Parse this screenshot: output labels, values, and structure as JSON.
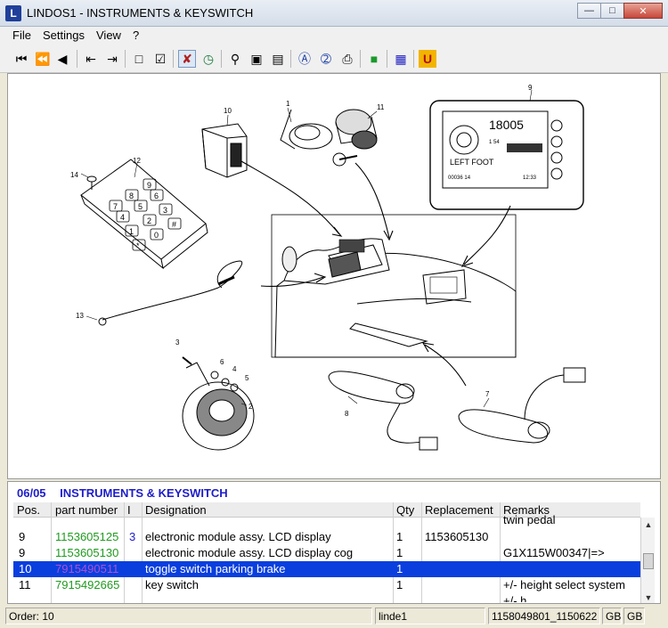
{
  "window": {
    "icon_letter": "L",
    "title": "LINDOS1 - INSTRUMENTS & KEYSWITCH"
  },
  "menu": [
    "File",
    "Settings",
    "View",
    "?"
  ],
  "toolbar_icons": [
    "first-page-icon",
    "prev-group-icon",
    "prev-icon",
    "bookmark-back-icon",
    "bookmark-forward-icon",
    "cart-icon",
    "order-list-icon",
    "pick-icon",
    "clock-icon",
    "zoom-icon",
    "page-icon",
    "page-alt-icon",
    "search-a-icon",
    "search-2-icon",
    "print-icon",
    "green-book-icon",
    "blue-grid-icon",
    "u-icon"
  ],
  "drawing": {
    "callouts": [
      "1",
      "2",
      "3",
      "4",
      "5",
      "6",
      "7",
      "8",
      "9",
      "10",
      "11",
      "12",
      "13",
      "14"
    ],
    "display": {
      "digits": "18005",
      "message": "LEFT FOOT",
      "counter": "00036 14",
      "time": "12:33",
      "small": "1 54"
    },
    "keypad": [
      "7",
      "8",
      "9",
      "4",
      "5",
      "6",
      "1",
      "2",
      "3",
      "*",
      "0",
      "#"
    ]
  },
  "parts": {
    "section_code": "06/05",
    "section_title": "INSTRUMENTS & KEYSWITCH",
    "headers": {
      "pos": "Pos.",
      "part_number": "part number",
      "i": "I",
      "designation": "Designation",
      "qty": "Qty",
      "replacement": "Replacement",
      "remarks": "Remarks"
    },
    "rows": [
      {
        "pos": "",
        "part_number": "",
        "i": "",
        "designation": "",
        "qty": "",
        "replacement": "",
        "remarks": "twin pedal",
        "partial": true
      },
      {
        "pos": "9",
        "part_number": "1153605125",
        "i": "3",
        "designation": "electronic module assy. LCD display",
        "qty": "1",
        "replacement": "1153605130",
        "remarks": ""
      },
      {
        "pos": "9",
        "part_number": "1153605130",
        "i": "",
        "designation": "electronic module assy. LCD display cog",
        "qty": "1",
        "replacement": "",
        "remarks": "G1X115W00347|=>"
      },
      {
        "pos": "10",
        "part_number": "7915490511",
        "i": "",
        "designation": "toggle switch parking brake",
        "qty": "1",
        "replacement": "",
        "remarks": "",
        "selected": true
      },
      {
        "pos": "11",
        "part_number": "7915492665",
        "i": "",
        "designation": "key switch",
        "qty": "1",
        "replacement": "",
        "remarks": "+/- height select system"
      },
      {
        "pos": "",
        "part_number": "",
        "i": "",
        "designation": "",
        "qty": "",
        "replacement": "",
        "remarks": "+/- h ... ",
        "partial": true
      }
    ]
  },
  "status": {
    "order": "Order: 10",
    "user": "linde1",
    "ids": "1158049801_1150622",
    "lang1": "GB",
    "lang2": "GB"
  }
}
